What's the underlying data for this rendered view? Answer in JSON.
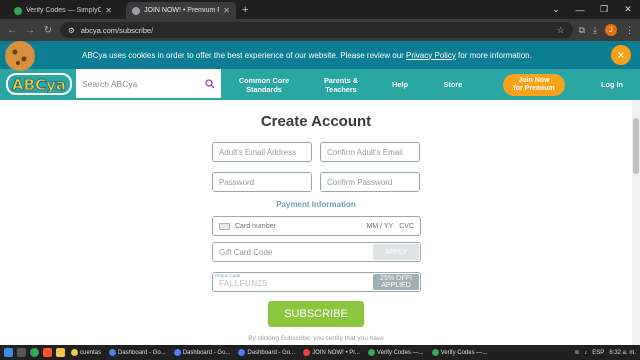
{
  "browser": {
    "tabs": [
      {
        "title": "Verify Codes — SimplyCodes",
        "active": false,
        "color": "#34a853"
      },
      {
        "title": "JOIN NOW! • Premium Family -",
        "active": true,
        "color": "#9aa0a6"
      }
    ],
    "new_tab": "+",
    "url": "abcya.com/subscribe/",
    "profile_initial": "J"
  },
  "cookie_banner": {
    "text_before": "ABCya uses cookies in order to offer the best experience of our website. Please review our ",
    "link": "Privacy Policy",
    "text_after": " for more information.",
    "close": "×"
  },
  "site": {
    "logo": "ABCya",
    "search_placeholder": "Search ABCya",
    "nav": {
      "common_core_1": "Common Core",
      "common_core_2": "Standards",
      "parents_1": "Parents &",
      "parents_2": "Teachers",
      "help": "Help",
      "store": "Store",
      "join_1": "Join Now",
      "join_2": "for Premium",
      "login": "Log In"
    }
  },
  "form": {
    "title": "Create Account",
    "email_placeholder": "Adult's Email Address",
    "confirm_email_placeholder": "Confirm Adult's Email",
    "password_placeholder": "Password",
    "confirm_password_placeholder": "Confirm Password",
    "payment_heading": "Payment Information",
    "card_number": "Card number",
    "card_expiry": "MM / YY",
    "card_cvc": "CVC",
    "gift_card_placeholder": "Gift Card Code",
    "apply": "APPLY",
    "promo_label": "Promo Code",
    "promo_value": "FALLFUN25",
    "promo_badge_1": "25% OFF!",
    "promo_badge_2": "APPLIED",
    "subscribe": "SUBSCRIBE",
    "disclaimer": "By clicking Subscribe, you certify that you have"
  },
  "taskbar": {
    "items": [
      {
        "label": "cuentas",
        "color": "#f2c94c"
      },
      {
        "label": "Dashboard - Go...",
        "color": "#4285f4"
      },
      {
        "label": "Dashboard - Go...",
        "color": "#4285f4"
      },
      {
        "label": "Dashboard - Go...",
        "color": "#4285f4"
      },
      {
        "label": "JOIN NOW! • Pr...",
        "color": "#ea4335"
      },
      {
        "label": "Verify Codes —...",
        "color": "#34a853"
      },
      {
        "label": "Verify Codes —...",
        "color": "#34a853"
      }
    ],
    "lang": "ESP",
    "time": "6:32 a. m."
  },
  "colors": {
    "teal_banner": "#0d7d93",
    "teal_nav": "#2aa6a3",
    "orange": "#f6a21a",
    "green_subscribe": "#8cc63f"
  }
}
